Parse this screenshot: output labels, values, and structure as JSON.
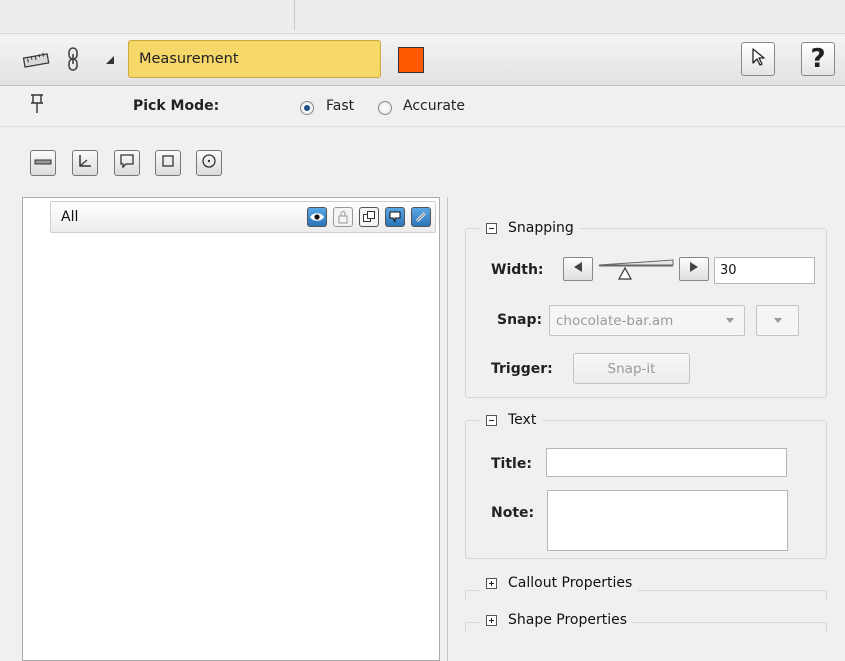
{
  "header": {
    "object_name": "Measurement",
    "color": "#ff5a00",
    "icons": [
      "ruler-icon",
      "link-icon",
      "collapse-triangle-icon"
    ],
    "pointer_button_icon": "cursor-arrow-icon",
    "help_label": "?"
  },
  "pick_mode": {
    "label": "Pick Mode:",
    "options": [
      {
        "label": "Fast",
        "selected": true
      },
      {
        "label": "Accurate",
        "selected": false
      }
    ]
  },
  "shape_tools": [
    "ruler-tool-icon",
    "angle-tool-icon",
    "callout-tool-icon",
    "rectangle-tool-icon",
    "circle-tool-icon"
  ],
  "tree": {
    "root_label": "All",
    "row_icons": [
      "visibility-eye-icon",
      "lock-icon",
      "copy-icon",
      "callout-icon",
      "link-toggle-icon"
    ]
  },
  "snapping": {
    "title": "Snapping",
    "width_label": "Width:",
    "width_value": "30",
    "snap_label": "Snap:",
    "snap_value": "chocolate-bar.am",
    "trigger_label": "Trigger:",
    "trigger_button": "Snap-it"
  },
  "text_group": {
    "title": "Text",
    "title_label": "Title:",
    "title_value": "",
    "note_label": "Note:",
    "note_value": ""
  },
  "collapsed_groups": {
    "callout": "Callout Properties",
    "shape": "Shape Properties"
  }
}
